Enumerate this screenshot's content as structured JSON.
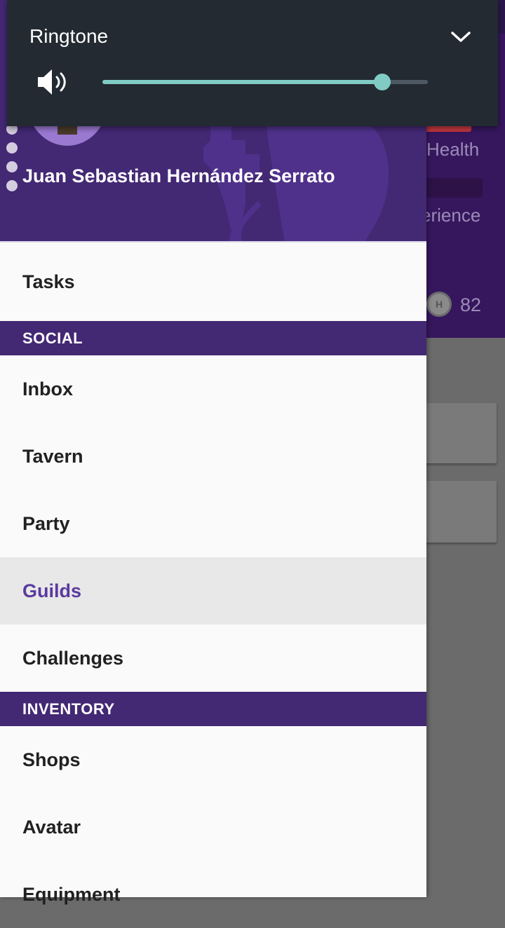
{
  "background": {
    "health_label": "Health",
    "experience_label": "erience",
    "gold_amount": "82",
    "coin_letter": "H"
  },
  "drawer": {
    "user_name": "Juan Sebastian Hernández Serrato",
    "items": {
      "tasks": "Tasks",
      "social_header": "SOCIAL",
      "inbox": "Inbox",
      "tavern": "Tavern",
      "party": "Party",
      "guilds": "Guilds",
      "challenges": "Challenges",
      "inventory_header": "INVENTORY",
      "shops": "Shops",
      "avatar": "Avatar",
      "equipment": "Equipment"
    },
    "selected": "Guilds"
  },
  "volume": {
    "title": "Ringtone",
    "level_percent": 86,
    "accent_color": "#80cbc4"
  }
}
